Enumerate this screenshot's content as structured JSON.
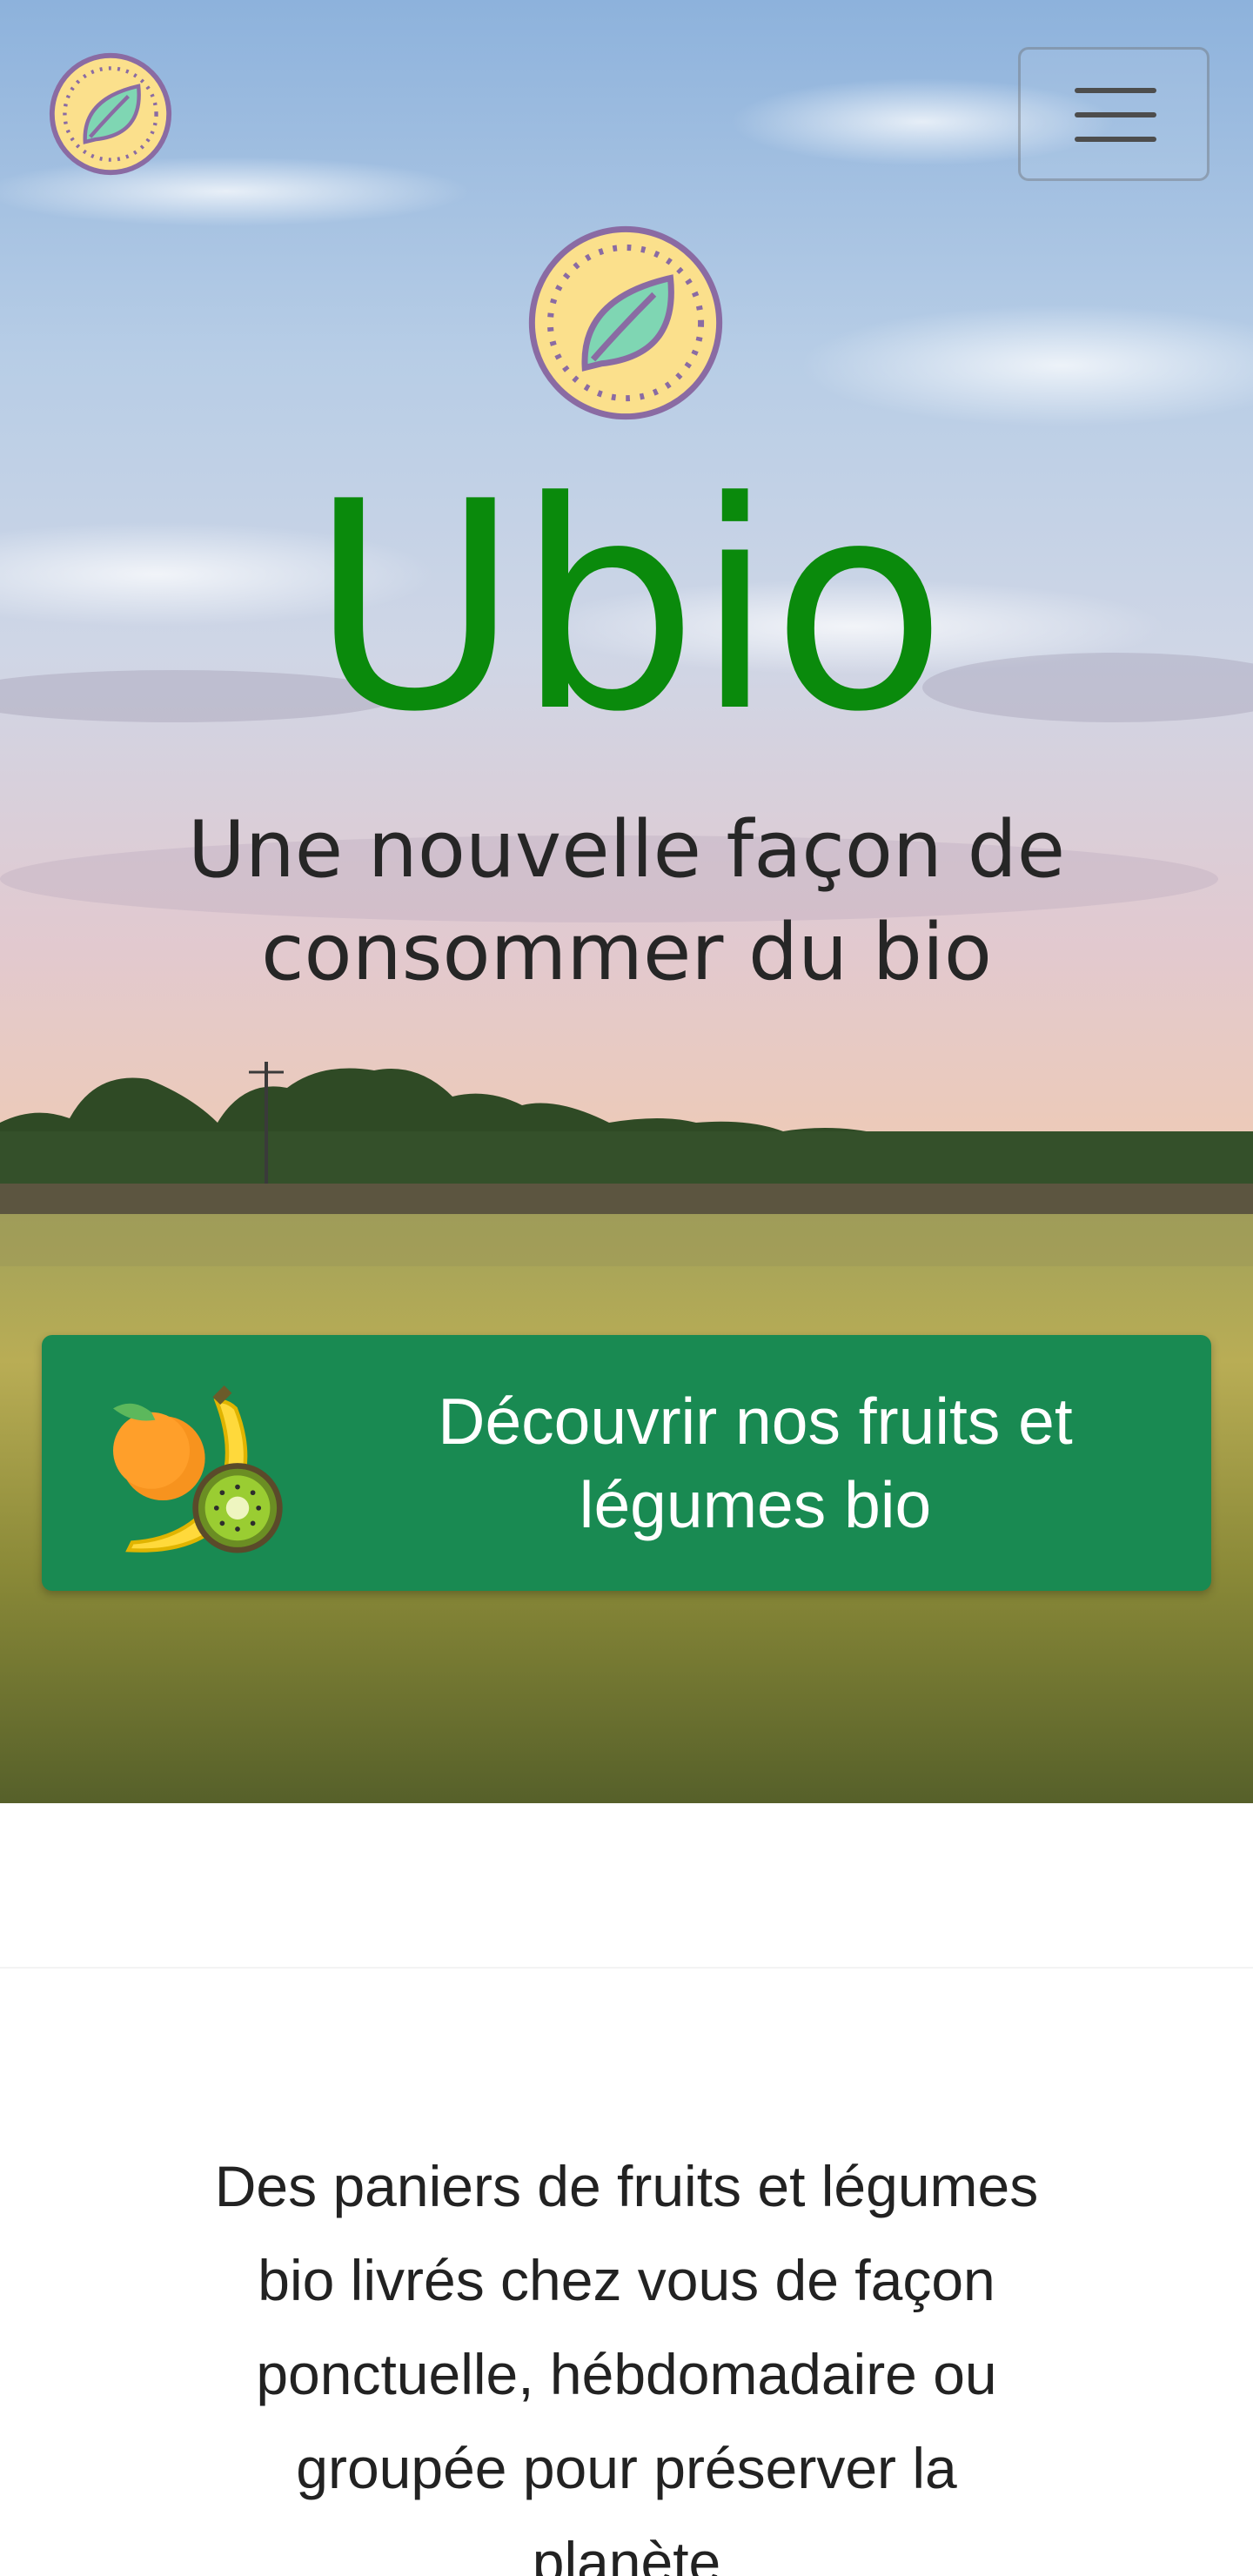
{
  "navbar": {
    "logo_icon": "leaf-badge-icon",
    "menu_icon": "hamburger-menu-icon"
  },
  "hero": {
    "logo_icon": "leaf-badge-icon",
    "title": "Ubio",
    "tagline": "Une nouvelle façon de consommer du bio",
    "cta": {
      "icon": "fruits-icon",
      "label": "Découvrir nos fruits et légumes bio"
    }
  },
  "intro": {
    "text": "Des paniers de fruits et légumes bio livrés chez vous de façon ponctuelle, hébdomadaire ou groupée pour préserver la planète"
  },
  "colors": {
    "brand_green": "#0a8a0c",
    "cta_green": "#198a52",
    "badge_yellow": "#fbe08c",
    "badge_purple": "#8a6ba3",
    "leaf_mint": "#7fd6b3"
  }
}
